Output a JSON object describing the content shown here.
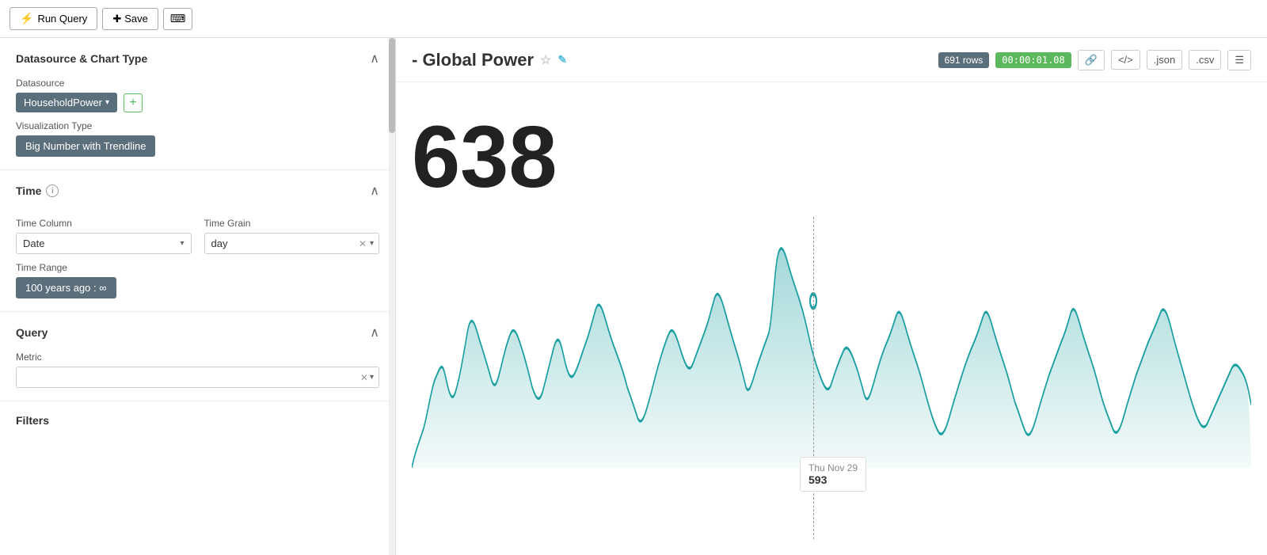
{
  "toolbar": {
    "run_query_label": "Run Query",
    "save_label": "Save",
    "run_icon": "⚡"
  },
  "left_panel": {
    "sections": {
      "datasource": {
        "title": "Datasource & Chart Type",
        "datasource_label": "Datasource",
        "datasource_value": "HouseholdPower",
        "viz_label": "Visualization Type",
        "viz_value": "Big Number with Trendline"
      },
      "time": {
        "title": "Time",
        "time_column_label": "Time Column",
        "time_column_value": "Date",
        "time_grain_label": "Time Grain",
        "time_grain_value": "day",
        "time_range_label": "Time Range",
        "time_range_value": "100 years ago : ∞"
      },
      "query": {
        "title": "Query",
        "metric_label": "Metric",
        "metric_value": "",
        "metric_placeholder": ""
      },
      "filters": {
        "title": "Filters"
      }
    }
  },
  "chart": {
    "title": "- Global Power",
    "big_number": "638",
    "rows_badge": "691 rows",
    "time_badge": "00:00:01.08",
    "tooltip": {
      "date": "Thu Nov 29",
      "value": "593"
    }
  },
  "toolbar_icons": {
    "link": "🔗",
    "code": "</>",
    "json": ".json",
    "csv": ".csv",
    "menu": "☰"
  }
}
